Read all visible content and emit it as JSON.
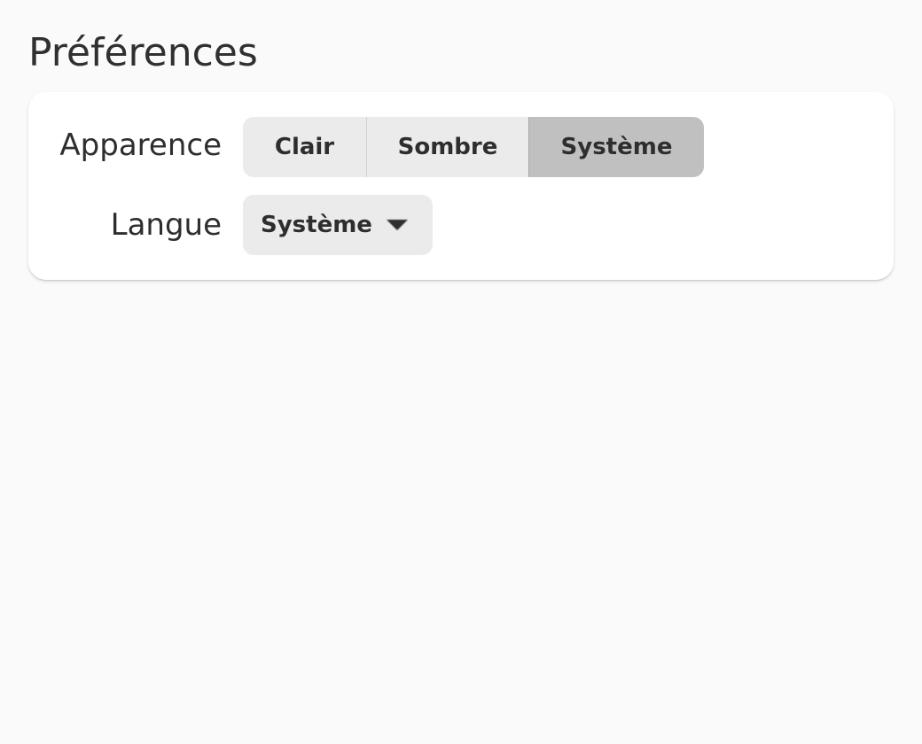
{
  "page": {
    "title": "Préférences"
  },
  "appearance": {
    "label": "Apparence",
    "options": [
      "Clair",
      "Sombre",
      "Système"
    ],
    "selected": "Système"
  },
  "language": {
    "label": "Langue",
    "selected_value": "Système"
  },
  "icons": {
    "dropdown_arrow": "chevron-down-icon"
  },
  "colors": {
    "background": "#fafafa",
    "card": "#ffffff",
    "segment": "#ebebeb",
    "segment_selected": "#c0c0c0",
    "text": "#2e2e2e"
  }
}
